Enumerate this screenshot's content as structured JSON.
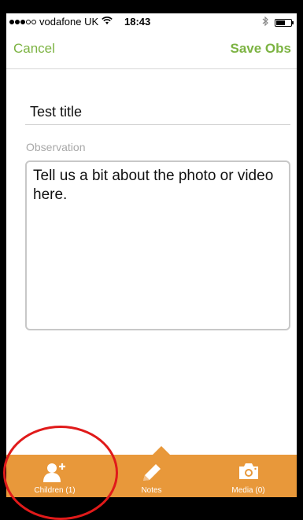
{
  "status_bar": {
    "carrier": "vodafone UK",
    "time": "18:43",
    "signal_bars_filled": 3,
    "signal_bars_total": 5,
    "battery_level": 0.6
  },
  "nav": {
    "cancel_label": "Cancel",
    "save_label": "Save Obs"
  },
  "form": {
    "title_value": "Test title",
    "observation_label": "Observation",
    "observation_text": "Tell us a bit about the photo or video here."
  },
  "tabs": [
    {
      "label": "Children (1)",
      "icon": "add-person-icon"
    },
    {
      "label": "Notes",
      "icon": "pencil-icon",
      "selected": true
    },
    {
      "label": "Media (0)",
      "icon": "camera-icon"
    }
  ],
  "colors": {
    "accent_green": "#7cb342",
    "tab_bar_orange": "#e8983a",
    "annotation_red": "#e01a1a"
  }
}
